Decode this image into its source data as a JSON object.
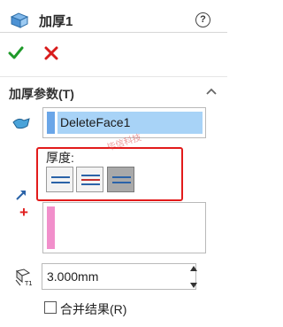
{
  "header": {
    "title": "加厚1",
    "help_label": "?",
    "feature_icon": "thicken-feature-icon",
    "ok_icon": "checkmark-icon",
    "cancel_icon": "x-icon",
    "ok_color": "#1f9a2a",
    "cancel_color": "#d91c1c"
  },
  "thicken_params": {
    "section_title": "加厚参数(T)",
    "collapse_icon": "chevron-up-icon",
    "face_selection": "DeleteFace1",
    "thickness_label": "厚度:",
    "thickness_side_buttons": [
      "side-1-icon",
      "both-sides-icon",
      "side-2-icon"
    ],
    "selected_side_index": 2,
    "direction_icon": "direction-arrow-icon",
    "add_icon": "+",
    "thickness_value": "3.000mm",
    "merge_result_label": "合并结果(R)",
    "merge_result_checked": false
  },
  "watermark": "毕信科技",
  "colors": {
    "selection_highlight": "#a8d3f7",
    "selection_accent": "#6aa6e8",
    "pink_accent": "#f18fcb",
    "highlight_frame": "#e21b1b"
  }
}
